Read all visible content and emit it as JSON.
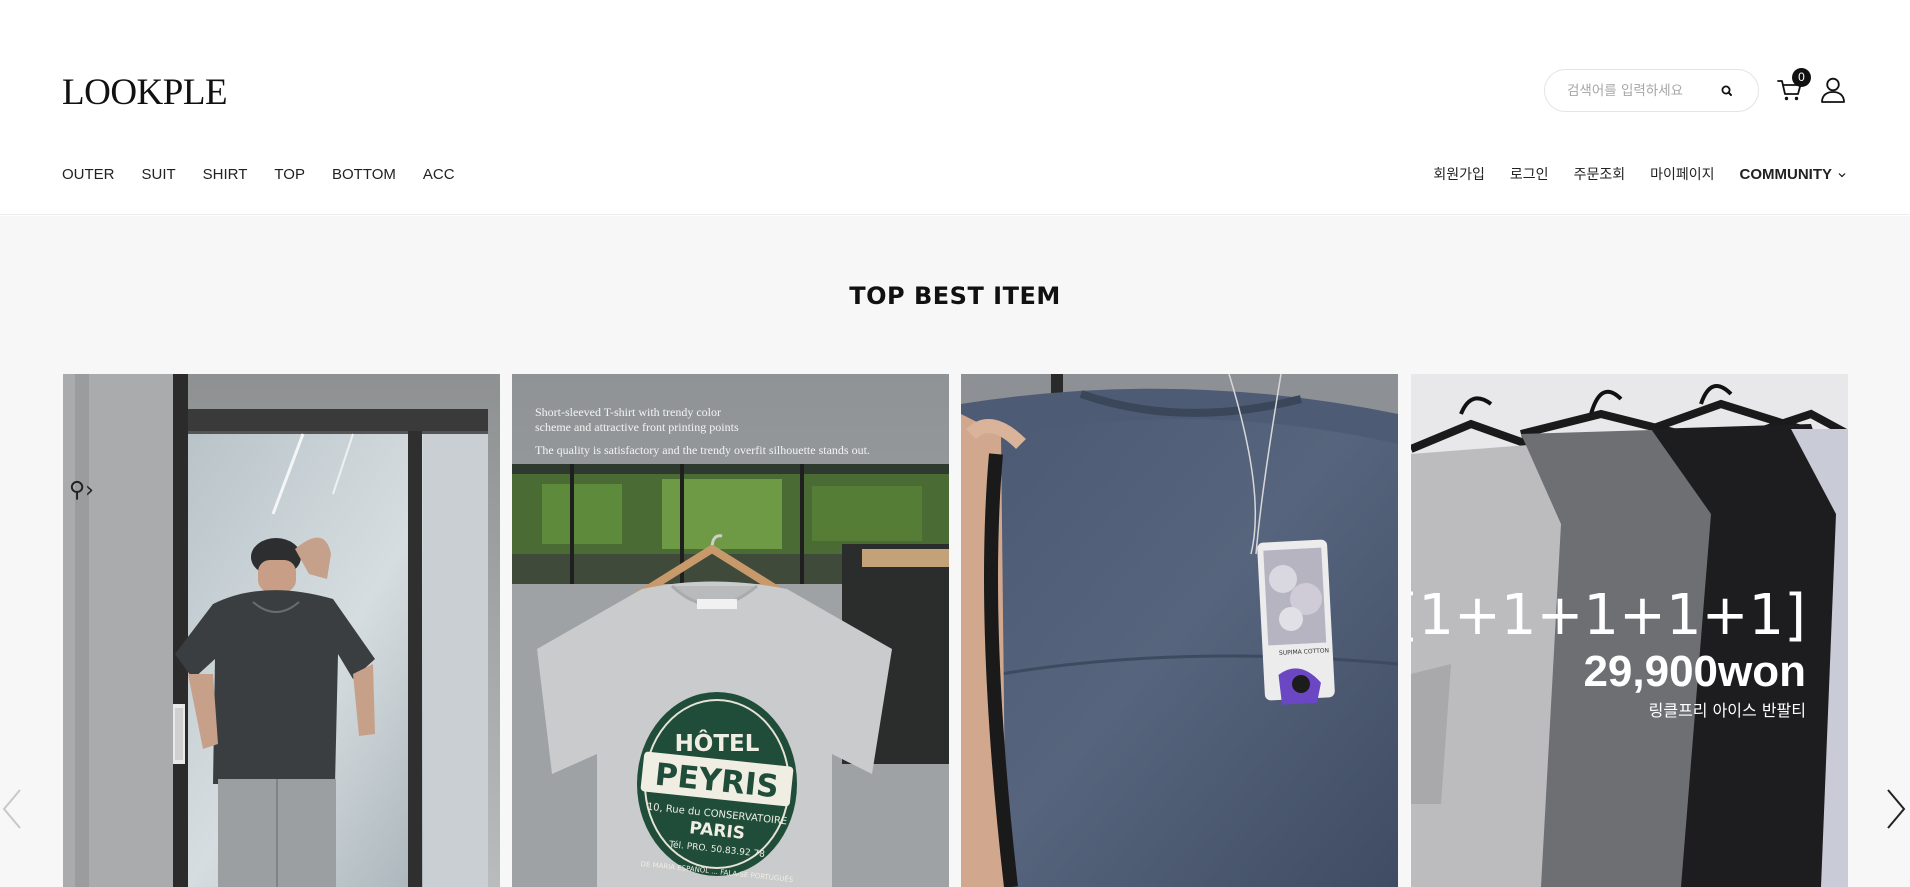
{
  "header": {
    "logo": "LOOKPLE",
    "search": {
      "placeholder": "검색어를 입력하세요",
      "value": ""
    },
    "cart_count": "0",
    "category_nav": [
      {
        "label": "OUTER"
      },
      {
        "label": "SUIT"
      },
      {
        "label": "SHIRT"
      },
      {
        "label": "TOP"
      },
      {
        "label": "BOTTOM"
      },
      {
        "label": "ACC"
      }
    ],
    "utility_nav": {
      "join": "회원가입",
      "login": "로그인",
      "orders": "주문조회",
      "mypage": "마이페이지",
      "community": "COMMUNITY"
    }
  },
  "section": {
    "title": "TOP BEST ITEM"
  },
  "products": [
    {
      "image": "model-wearing-charcoal-tshirt-photo"
    },
    {
      "image": "grey-hotel-peyris-tshirt-photo",
      "overlay_line_1": "Short-sleeved T-shirt with trendy color",
      "overlay_line_2": "scheme and attractive front printing points",
      "overlay_line_3": "The quality is satisfactory and the trendy overfit silhouette stands out.",
      "print_top": "HÔTEL",
      "print_main": "PEYRIS",
      "print_sub_1": "10, Rue du CONSERVATOIRE",
      "print_sub_2": "PARIS",
      "print_sub_3": "Tél. PRO. 50.83.92 78",
      "print_bottom": "DE MARIA ESPAÑOL ... FALA-SE PORTUGUÊS"
    },
    {
      "image": "navy-tshirt-back-with-tag-photo",
      "tag_text": "SUPIMA COTTON"
    },
    {
      "image": "hanging-tshirts-set-photo",
      "promo_title": "[1+1+1+1+1]",
      "promo_price": "29,900won",
      "promo_subtitle": "링클프리 아이스 반팔티"
    }
  ],
  "colors": {
    "background": "#f7f7f7",
    "header_bg": "#ffffff",
    "text": "#111111",
    "badge": "#111111"
  }
}
